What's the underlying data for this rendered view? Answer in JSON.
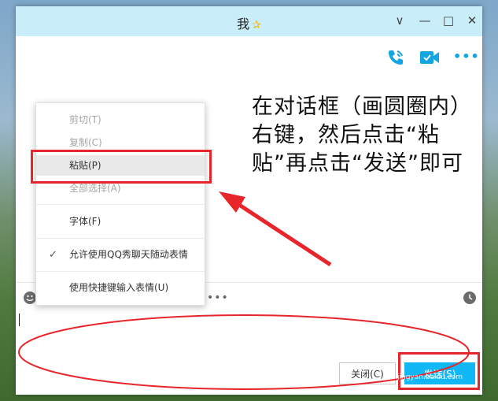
{
  "window": {
    "title": "我",
    "controls": {
      "minimize": "∨",
      "restore": "—",
      "maximize": "□",
      "close": "✕"
    }
  },
  "toolbar": {
    "icons": [
      "phone-call-icon",
      "video-call-icon",
      "more-options-icon"
    ],
    "more_label": "•••"
  },
  "annotation": {
    "text": "在对话框（画圆圈内）右键，然后点击“粘贴”再点击“发送”即可"
  },
  "context_menu": {
    "items": [
      {
        "label": "剪切(T)",
        "enabled": false
      },
      {
        "label": "复制(C)",
        "enabled": false
      },
      {
        "label": "粘贴(P)",
        "enabled": true,
        "highlighted": true
      },
      {
        "label": "全部选择(A)",
        "enabled": false
      },
      {
        "label": "字体(F)",
        "enabled": true
      },
      {
        "label": "允许使用QQ秀聊天随动表情",
        "enabled": true,
        "checked": true
      },
      {
        "label": "使用快捷键输入表情(U)",
        "enabled": true
      }
    ]
  },
  "input_toolbar": {
    "icons": [
      "emoji-icon",
      "history-clock-icon"
    ],
    "more_label": "•••"
  },
  "buttons": {
    "close_label": "关闭(C)",
    "send_label": "发送(S)"
  },
  "watermark": "jingyan.baidu.com",
  "colors": {
    "titlebar": "#c9eefa",
    "accent": "#12b7f5",
    "highlight_red": "#e8252b"
  }
}
